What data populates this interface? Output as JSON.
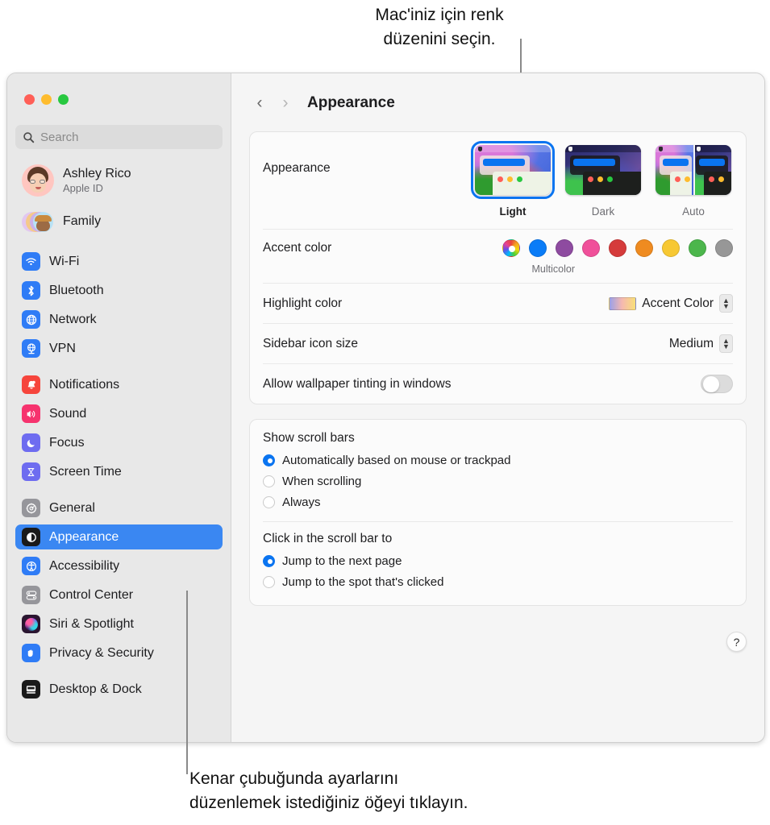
{
  "callouts": {
    "top": "Mac'iniz için renk\ndüzenini seçin.",
    "bottom": "Kenar çubuğunda ayarlarını\ndüzenlemek istediğiniz öğeyi tıklayın."
  },
  "window": {
    "traffic_lights": [
      "close-red",
      "minimize-yellow",
      "zoom-green"
    ]
  },
  "sidebar": {
    "search": {
      "placeholder": "Search",
      "value": "",
      "icon": "search-icon"
    },
    "account": {
      "name": "Ashley Rico",
      "subtitle": "Apple ID",
      "avatar": "memoji-avatar"
    },
    "family": {
      "label": "Family",
      "icon": "family-avatars-icon"
    },
    "groups": [
      {
        "items": [
          {
            "label": "Wi-Fi",
            "icon": "wifi-icon",
            "color": "#2f7cf6"
          },
          {
            "label": "Bluetooth",
            "icon": "bluetooth-icon",
            "color": "#2f7cf6"
          },
          {
            "label": "Network",
            "icon": "globe-icon",
            "color": "#2f7cf6"
          },
          {
            "label": "VPN",
            "icon": "vpn-globe-icon",
            "color": "#2f7cf6"
          }
        ]
      },
      {
        "items": [
          {
            "label": "Notifications",
            "icon": "bell-icon",
            "color": "#f6453c"
          },
          {
            "label": "Sound",
            "icon": "speaker-icon",
            "color": "#f6336e"
          },
          {
            "label": "Focus",
            "icon": "moon-icon",
            "color": "#6e6cf0"
          },
          {
            "label": "Screen Time",
            "icon": "hourglass-icon",
            "color": "#6e6cf0"
          }
        ]
      },
      {
        "items": [
          {
            "label": "General",
            "icon": "gear-icon",
            "color": "#96969b",
            "selected": false
          },
          {
            "label": "Appearance",
            "icon": "appearance-contrast-icon",
            "color": "#1a1a1a",
            "selected": true
          },
          {
            "label": "Accessibility",
            "icon": "accessibility-icon",
            "color": "#2f7cf6",
            "selected": false
          },
          {
            "label": "Control Center",
            "icon": "control-center-icon",
            "color": "#96969b",
            "selected": false
          },
          {
            "label": "Siri & Spotlight",
            "icon": "siri-icon",
            "color": "#2a1530",
            "selected": false
          },
          {
            "label": "Privacy & Security",
            "icon": "hand-icon",
            "color": "#2f7cf6",
            "selected": false
          }
        ]
      },
      {
        "items": [
          {
            "label": "Desktop & Dock",
            "icon": "desktop-dock-icon",
            "color": "#1a1a1a"
          }
        ]
      }
    ]
  },
  "main": {
    "nav": {
      "back": "‹",
      "forward": "›"
    },
    "title": "Appearance",
    "appearance": {
      "label": "Appearance",
      "options": [
        {
          "caption": "Light",
          "selected": true
        },
        {
          "caption": "Dark",
          "selected": false
        },
        {
          "caption": "Auto",
          "selected": false
        }
      ]
    },
    "accent": {
      "label": "Accent color",
      "caption": "Multicolor",
      "swatches": [
        {
          "name": "multicolor",
          "color": "multicolor",
          "selected": true
        },
        {
          "name": "blue",
          "color": "#0a7cf7"
        },
        {
          "name": "purple",
          "color": "#8e4ba0"
        },
        {
          "name": "pink",
          "color": "#f0509a"
        },
        {
          "name": "red",
          "color": "#d53b3b"
        },
        {
          "name": "orange",
          "color": "#ef8b20"
        },
        {
          "name": "yellow",
          "color": "#f7c833"
        },
        {
          "name": "green",
          "color": "#4cb64c"
        },
        {
          "name": "graphite",
          "color": "#979797"
        }
      ]
    },
    "highlight": {
      "label": "Highlight color",
      "value": "Accent Color"
    },
    "sidebar_icon_size": {
      "label": "Sidebar icon size",
      "value": "Medium"
    },
    "wallpaper_tinting": {
      "label": "Allow wallpaper tinting in windows",
      "on": false
    },
    "scroll_bars": {
      "title": "Show scroll bars",
      "options": [
        {
          "label": "Automatically based on mouse or trackpad",
          "selected": true
        },
        {
          "label": "When scrolling",
          "selected": false
        },
        {
          "label": "Always",
          "selected": false
        }
      ]
    },
    "scroll_click": {
      "title": "Click in the scroll bar to",
      "options": [
        {
          "label": "Jump to the next page",
          "selected": true
        },
        {
          "label": "Jump to the spot that's clicked",
          "selected": false
        }
      ]
    },
    "help": {
      "label": "?"
    }
  }
}
